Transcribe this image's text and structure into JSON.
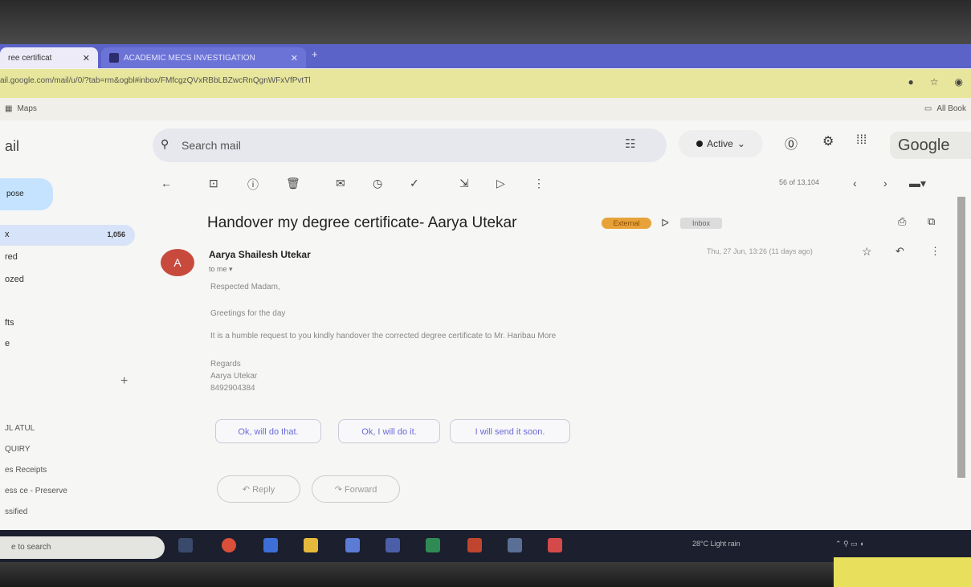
{
  "browser": {
    "tabs": [
      {
        "label": "ree certificat",
        "active": true
      },
      {
        "label": "ACADEMIC MECS INVESTIGATION",
        "active": false
      }
    ],
    "url": "ail.google.com/mail/u/0/?tab=rm&ogbl#inbox/FMfcgzQVxRBbLBZwcRnQgnWFxVfPvtTl",
    "bookmarks": {
      "maps": "Maps",
      "all": "All Book"
    }
  },
  "gmail": {
    "logo": "ail",
    "compose": "pose",
    "nav": {
      "inbox_label": "x",
      "inbox_count": "1,056",
      "items": [
        "red",
        "ozed",
        "fts",
        "e"
      ]
    },
    "sidebar_labels": [
      "JL ATUL",
      "QUIRY",
      "es Receipts",
      "ess ce - Preserve",
      "ssified"
    ],
    "search": {
      "placeholder": "Search mail"
    },
    "status": "Active",
    "google": "Google",
    "pagination": "56 of 13,104",
    "subject": "Handover my degree certificate- Aarya Utekar",
    "tags": {
      "external": "External",
      "inbox": "Inbox"
    },
    "sender": "Aarya Shailesh Utekar",
    "to": "to me",
    "date": "Thu, 27 Jun, 13:26 (11 days ago)",
    "body": [
      "Respected Madam,",
      "Greetings for the day",
      "It is a humble request to you kindly handover the corrected degree certificate to Mr. Haribau More",
      "Regards",
      "Aarya Utekar",
      "8492904384"
    ],
    "smart_replies": [
      "Ok, will do that.",
      "Ok, I will do it.",
      "I will send it soon."
    ],
    "actions": {
      "reply": "Reply",
      "forward": "Forward"
    }
  },
  "taskbar": {
    "search": "e to search",
    "weather": "28°C  Light rain"
  }
}
